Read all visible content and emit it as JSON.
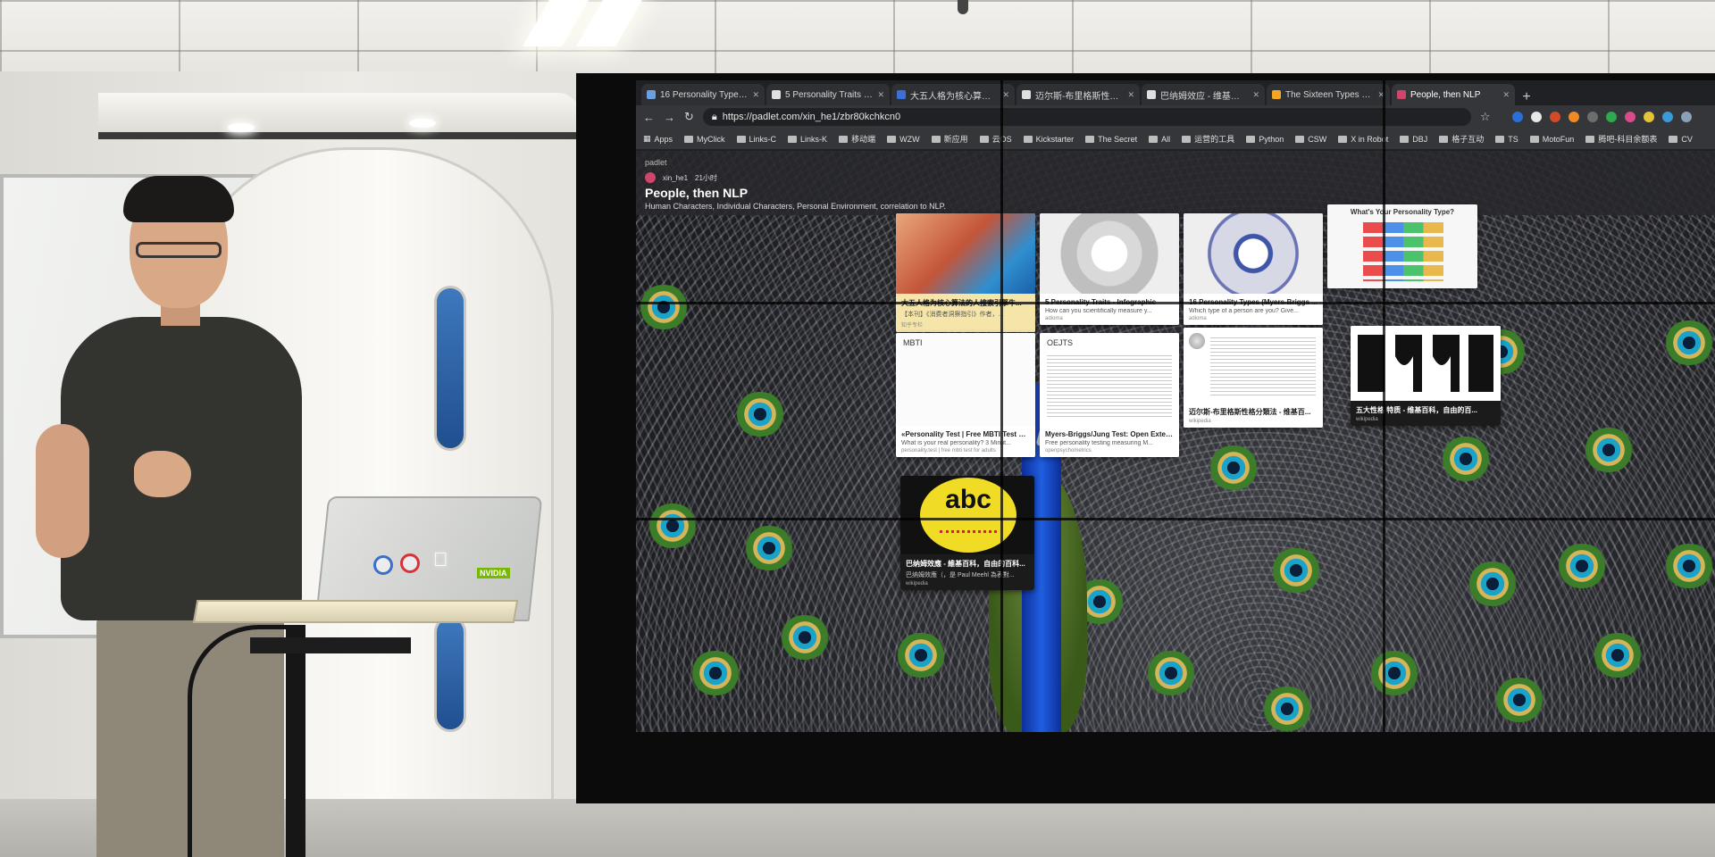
{
  "browser": {
    "tabs": [
      {
        "label": "16 Personality Types (Myers-B",
        "favicon_color": "#6aa0e0",
        "active": false
      },
      {
        "label": "5 Personality Traits - Infographic",
        "favicon_color": "#e0e0e0",
        "active": false
      },
      {
        "label": "大五人格为核心算法的人搜索引擎",
        "favicon_color": "#3d6fd8",
        "active": false
      },
      {
        "label": "迈尔斯-布里格斯性格分类法 - 维",
        "favicon_color": "#e0e0e0",
        "active": false
      },
      {
        "label": "巴纳姆效应 - 维基百科，自由的",
        "favicon_color": "#e0e0e0",
        "active": false
      },
      {
        "label": "The Sixteen Types at a Glance",
        "favicon_color": "#f2a623",
        "active": false
      },
      {
        "label": "People, then NLP",
        "favicon_color": "#d0456c",
        "active": true
      }
    ],
    "url": "https://padlet.com/xin_he1/zbr80kchkcn0",
    "bookmarks": [
      "Apps",
      "MyClick",
      "Links-C",
      "Links-K",
      "移动端",
      "WZW",
      "新应用",
      "云OS",
      "Kickstarter",
      "The Secret",
      "All",
      "运营的工具",
      "Python",
      "CSW",
      "X in Robot",
      "DBJ",
      "格子互动",
      "TS",
      "MotoFun",
      "腾吧-科目余额表",
      "CV"
    ]
  },
  "padlet": {
    "brand": "padlet",
    "author": "xin_he1",
    "time_ago": "21小时",
    "title": "People, then NLP",
    "subtitle": "Human Characters, Individual Characters, Personal Environment, correlation to NLP.",
    "cards": [
      {
        "title": "大五人格为核心算法的人搜索引擎牛...",
        "desc": "【本刊】《消费者洞察指引》作者，...",
        "source": "知乎专栏"
      },
      {
        "title": "5 Personality Traits - Infographic",
        "desc": "How can you scientifically measure y...",
        "source": "adioma"
      },
      {
        "title": "16 Personality Types (Myers-Briggs ...",
        "desc": "Which type of a person are you? Give...",
        "source": "adioma"
      },
      {
        "title": "What's Your Personality Type?",
        "desc": "",
        "source": ""
      },
      {
        "heading": "MBTI",
        "title": "«Personality Test | Free MBTI Test Fo...",
        "desc": "What is your real personality? 3 Minut...",
        "source": "personality.test | free mbti test for adults"
      },
      {
        "heading": "OEJTS",
        "title": "Myers-Briggs/Jung Test: Open Exten...",
        "desc": "Free personality testing measuring M...",
        "source": "openpsychometrics"
      },
      {
        "title": "迈尔斯-布里格斯性格分類法 - 维基百...",
        "desc": "",
        "source": "wikipedia"
      },
      {
        "title": "五大性格 特质 - 维基百科，自由的百...",
        "desc": "",
        "source": "wikipedia"
      },
      {
        "image_text": "abc",
        "title": "巴纳姆效應 - 維基百科，自由的百科...",
        "desc": "巴纳姆效應（，是 Paul Meehl 為表對...",
        "source": "wikipedia"
      }
    ]
  },
  "laptop": {
    "sticker_text": "NVIDIA"
  }
}
